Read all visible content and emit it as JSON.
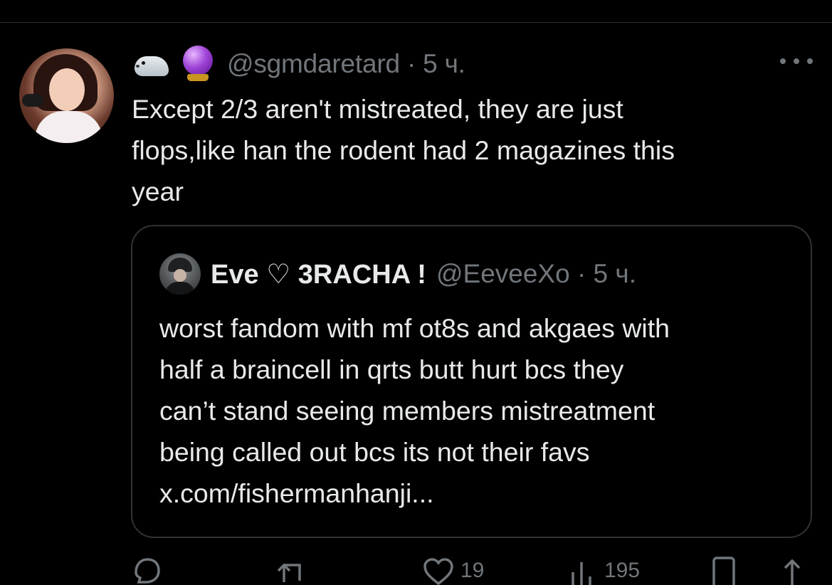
{
  "tweet": {
    "handle": "@sgmdaretard · 5 ч.",
    "emoji_1": "seal-icon",
    "emoji_2": "crystal-ball-icon",
    "text": "Except 2/3 aren't mistreated, they are just\nflops,like han the rodent had 2 magazines this\nyear"
  },
  "quote": {
    "name": "Eve ♡ 3RACHA !",
    "handle": "@EeveeXo · 5 ч.",
    "text": "worst fandom with mf ot8s and akgaes with\nhalf a braincell in qrts butt hurt bcs they\ncan’t stand seeing members mistreatment\nbeing called out bcs its not their favs\nx.com/fishermanhanji..."
  },
  "actions": {
    "reply_icon": "reply-icon",
    "retweet_icon": "retweet-icon",
    "like_icon": "heart-icon",
    "like_count": "19",
    "views_icon": "views-icon",
    "views_count": "195",
    "bookmark_icon": "bookmark-icon",
    "share_icon": "share-icon"
  },
  "colors": {
    "background": "#000000",
    "text": "#e7e9ea",
    "secondary": "#71767b",
    "border": "#2f3336"
  }
}
